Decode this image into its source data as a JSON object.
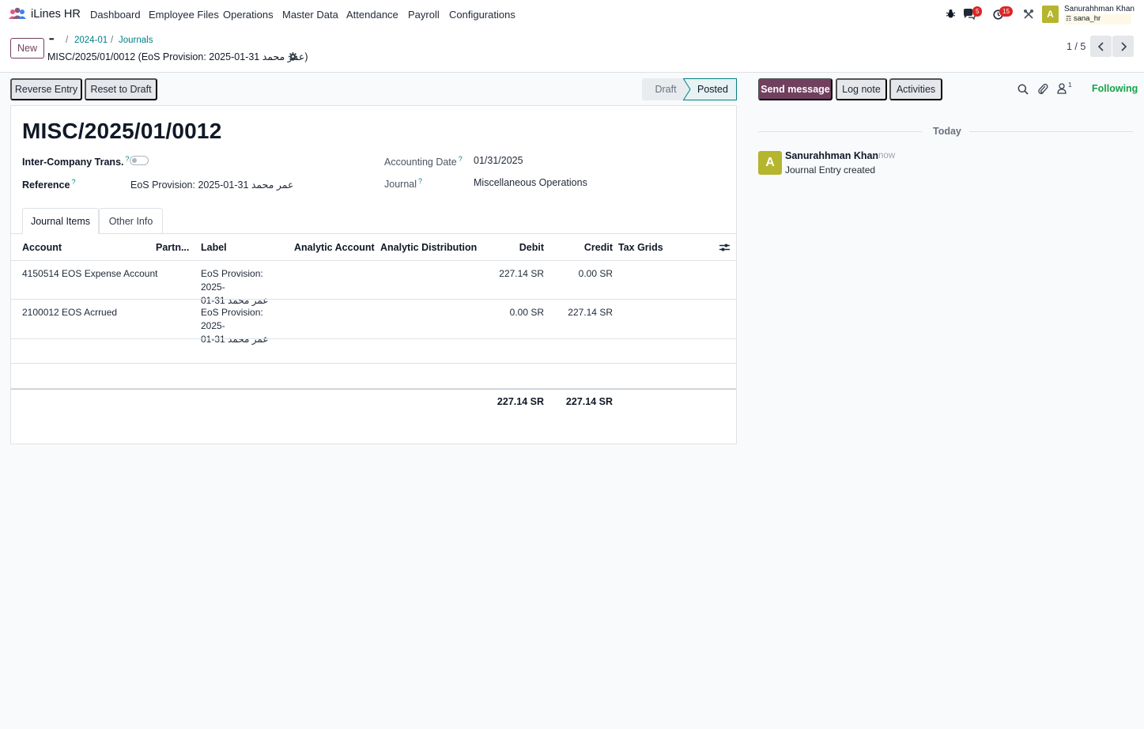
{
  "navbar": {
    "brand": "iLines HR",
    "menus": [
      "Dashboard",
      "Employee Files",
      "Operations",
      "Master Data",
      "Attendance",
      "Payroll",
      "Configurations"
    ],
    "messages_badge": "5",
    "activities_badge": "15",
    "user_name": "Sanurahhman Khan",
    "user_db": "sana_hr",
    "avatar_letter": "A"
  },
  "control": {
    "new_label": "New",
    "ellipsis": "•••",
    "breadcrumbs": [
      "2024-01",
      "Journals"
    ],
    "record_title": "MISC/2025/01/0012 (EoS Provision: 2025-01-31 عمر محمد)",
    "pager": "1 / 5"
  },
  "statusbar": {
    "reverse_label": "Reverse Entry",
    "reset_label": "Reset to Draft",
    "stages": [
      "Draft",
      "Posted"
    ],
    "current_stage": "Posted"
  },
  "form": {
    "name": "MISC/2025/01/0012",
    "inter_company_label": "Inter-Company Trans.",
    "inter_company_value": false,
    "reference_label": "Reference",
    "reference_value": "EoS Provision: 2025-01-31 عمر محمد",
    "accounting_date_label": "Accounting Date",
    "accounting_date_value": "01/31/2025",
    "journal_label": "Journal",
    "journal_value": "Miscellaneous Operations",
    "help_mark": "?"
  },
  "tabs": [
    "Journal Items",
    "Other Info"
  ],
  "table": {
    "headers": {
      "account": "Account",
      "partner": "Partn...",
      "label": "Label",
      "analytic_account": "Analytic Account",
      "analytic_distribution": "Analytic Distribution",
      "debit": "Debit",
      "credit": "Credit",
      "tax_grids": "Tax Grids"
    },
    "rows": [
      {
        "account": "4150514 EOS Expense Account",
        "label_line1": "EoS Provision: 2025-",
        "label_line2": "01-31 عمر محمد",
        "debit": "227.14 SR",
        "credit": "0.00 SR"
      },
      {
        "account": "2100012 EOS Acrrued",
        "label_line1": "EoS Provision: 2025-",
        "label_line2": "01-31 عمر محمد",
        "debit": "0.00 SR",
        "credit": "227.14 SR"
      }
    ],
    "total_debit": "227.14 SR",
    "total_credit": "227.14 SR"
  },
  "chatter": {
    "send_message": "Send message",
    "log_note": "Log note",
    "activities": "Activities",
    "followers_count": "1",
    "following": "Following",
    "today": "Today",
    "message": {
      "author": "Sanurahhman Khan",
      "time": "- now",
      "body": "Journal Entry created",
      "avatar_letter": "A"
    }
  },
  "colors": {
    "brand": "#71405f",
    "link": "#017e84",
    "avatar": "#b5b52e",
    "badge": "#dc2626",
    "following": "#16a34a"
  }
}
